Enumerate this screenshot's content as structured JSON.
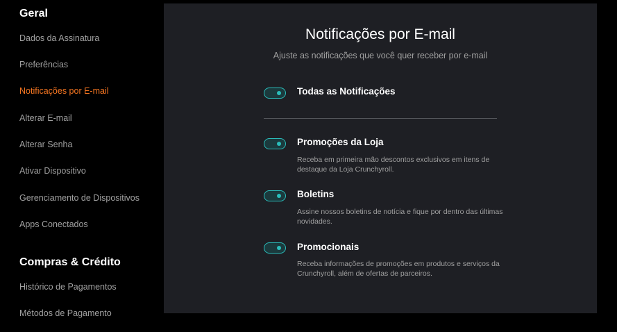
{
  "sidebar": {
    "sections": [
      {
        "title": "Geral",
        "items": [
          {
            "label": "Dados da Assinatura"
          },
          {
            "label": "Preferências"
          },
          {
            "label": "Notificações por E-mail",
            "active": true
          },
          {
            "label": "Alterar E-mail"
          },
          {
            "label": "Alterar Senha"
          },
          {
            "label": "Ativar Dispositivo"
          },
          {
            "label": "Gerenciamento de Dispositivos"
          },
          {
            "label": "Apps Conectados"
          }
        ]
      },
      {
        "title": "Compras & Crédito",
        "items": [
          {
            "label": "Histórico de Pagamentos"
          },
          {
            "label": "Métodos de Pagamento"
          }
        ]
      }
    ]
  },
  "panel": {
    "title": "Notificações por E-mail",
    "subtitle": "Ajuste as notificações que você quer receber por e-mail",
    "master": {
      "label": "Todas as Notificações",
      "enabled": true
    },
    "options": [
      {
        "label": "Promoções da Loja",
        "description": "Receba em primeira mão descontos exclusivos em itens de destaque da Loja Crunchyroll.",
        "enabled": true
      },
      {
        "label": "Boletins",
        "description": "Assine nossos boletins de notícia e fique por dentro das últimas novidades.",
        "enabled": true
      },
      {
        "label": "Promocionais",
        "description": "Receba informações de promoções em produtos e serviços da Crunchyroll, além de ofertas de parceiros.",
        "enabled": true
      }
    ]
  },
  "colors": {
    "accent": "#f47521",
    "toggle": "#2abdbb",
    "panel_bg": "#1e1f24",
    "page_bg": "#000000"
  }
}
